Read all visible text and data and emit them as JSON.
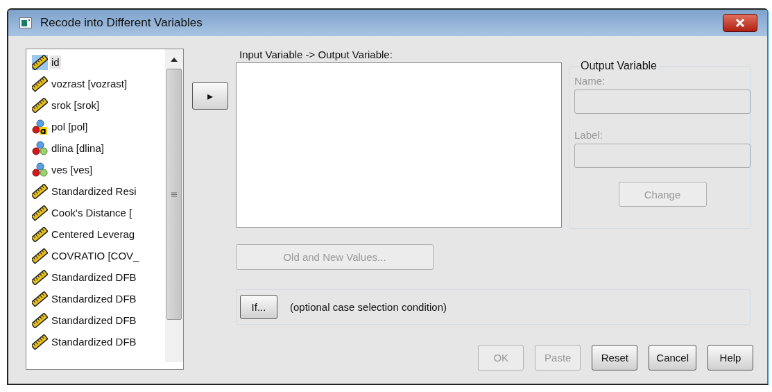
{
  "window": {
    "title": "Recode into Different Variables"
  },
  "variables": [
    {
      "label": "id",
      "kind": "scale",
      "selected": true
    },
    {
      "label": "vozrast [vozrast]",
      "kind": "scale",
      "selected": false
    },
    {
      "label": "srok [srok]",
      "kind": "scale",
      "selected": false
    },
    {
      "label": "pol [pol]",
      "kind": "nominal_string",
      "selected": false
    },
    {
      "label": "dlina [dlina]",
      "kind": "nominal",
      "selected": false
    },
    {
      "label": "ves [ves]",
      "kind": "nominal",
      "selected": false
    },
    {
      "label": "Standardized Resi",
      "kind": "scale",
      "selected": false
    },
    {
      "label": "Cook's Distance [",
      "kind": "scale",
      "selected": false
    },
    {
      "label": "Centered Leverag",
      "kind": "scale",
      "selected": false
    },
    {
      "label": "COVRATIO [COV_",
      "kind": "scale",
      "selected": false
    },
    {
      "label": "Standardized DFB",
      "kind": "scale",
      "selected": false
    },
    {
      "label": "Standardized DFB",
      "kind": "scale",
      "selected": false
    },
    {
      "label": "Standardized DFB",
      "kind": "scale",
      "selected": false
    },
    {
      "label": "Standardized DFB",
      "kind": "scale",
      "selected": false
    }
  ],
  "move_button": {
    "symbol": "▸"
  },
  "mapping": {
    "label": "Input Variable -> Output Variable:"
  },
  "output_variable": {
    "title": "Output Variable",
    "name_label": "Name:",
    "label_label": "Label:",
    "disabled": true,
    "change_button": {
      "label": "Change",
      "disabled": true
    }
  },
  "old_new_button": {
    "label": "Old and New Values...",
    "disabled": true
  },
  "if": {
    "button": "If...",
    "text": "(optional case selection condition)"
  },
  "buttons": [
    {
      "label": "OK",
      "disabled": true
    },
    {
      "label": "Paste",
      "disabled": true
    },
    {
      "label": "Reset",
      "disabled": false
    },
    {
      "label": "Cancel",
      "disabled": false
    },
    {
      "label": "Help",
      "disabled": false
    }
  ]
}
